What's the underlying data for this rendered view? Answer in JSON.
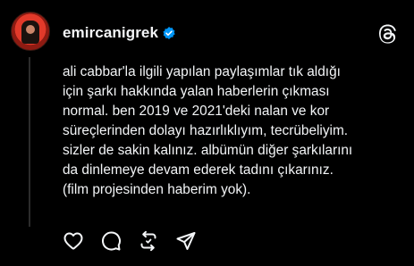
{
  "post": {
    "username": "emircanigrek",
    "body": "ali cabbar'la ilgili yapılan paylaşımlar tık aldığı\niçin şarkı hakkında yalan haberlerin çıkması\nnormal. ben 2019 ve 2021'deki nalan ve kor\nsüreçlerinden dolayı hazırlıklıyım, tecrübeliyim.\nsizler de sakin kalınız. albümün diğer şarkılarını\nda dinlemeye devam ederek tadını çıkarınız.\n(film projesinden haberim yok).",
    "verified": true
  },
  "icons": {
    "verified": "verified-badge-icon",
    "app_logo": "threads-logo-icon",
    "like": "heart-icon",
    "reply": "comment-icon",
    "repost": "repost-icon",
    "share": "send-icon"
  },
  "colors": {
    "background": "#000000",
    "text": "#f3f5f7",
    "verified": "#0095f6"
  }
}
